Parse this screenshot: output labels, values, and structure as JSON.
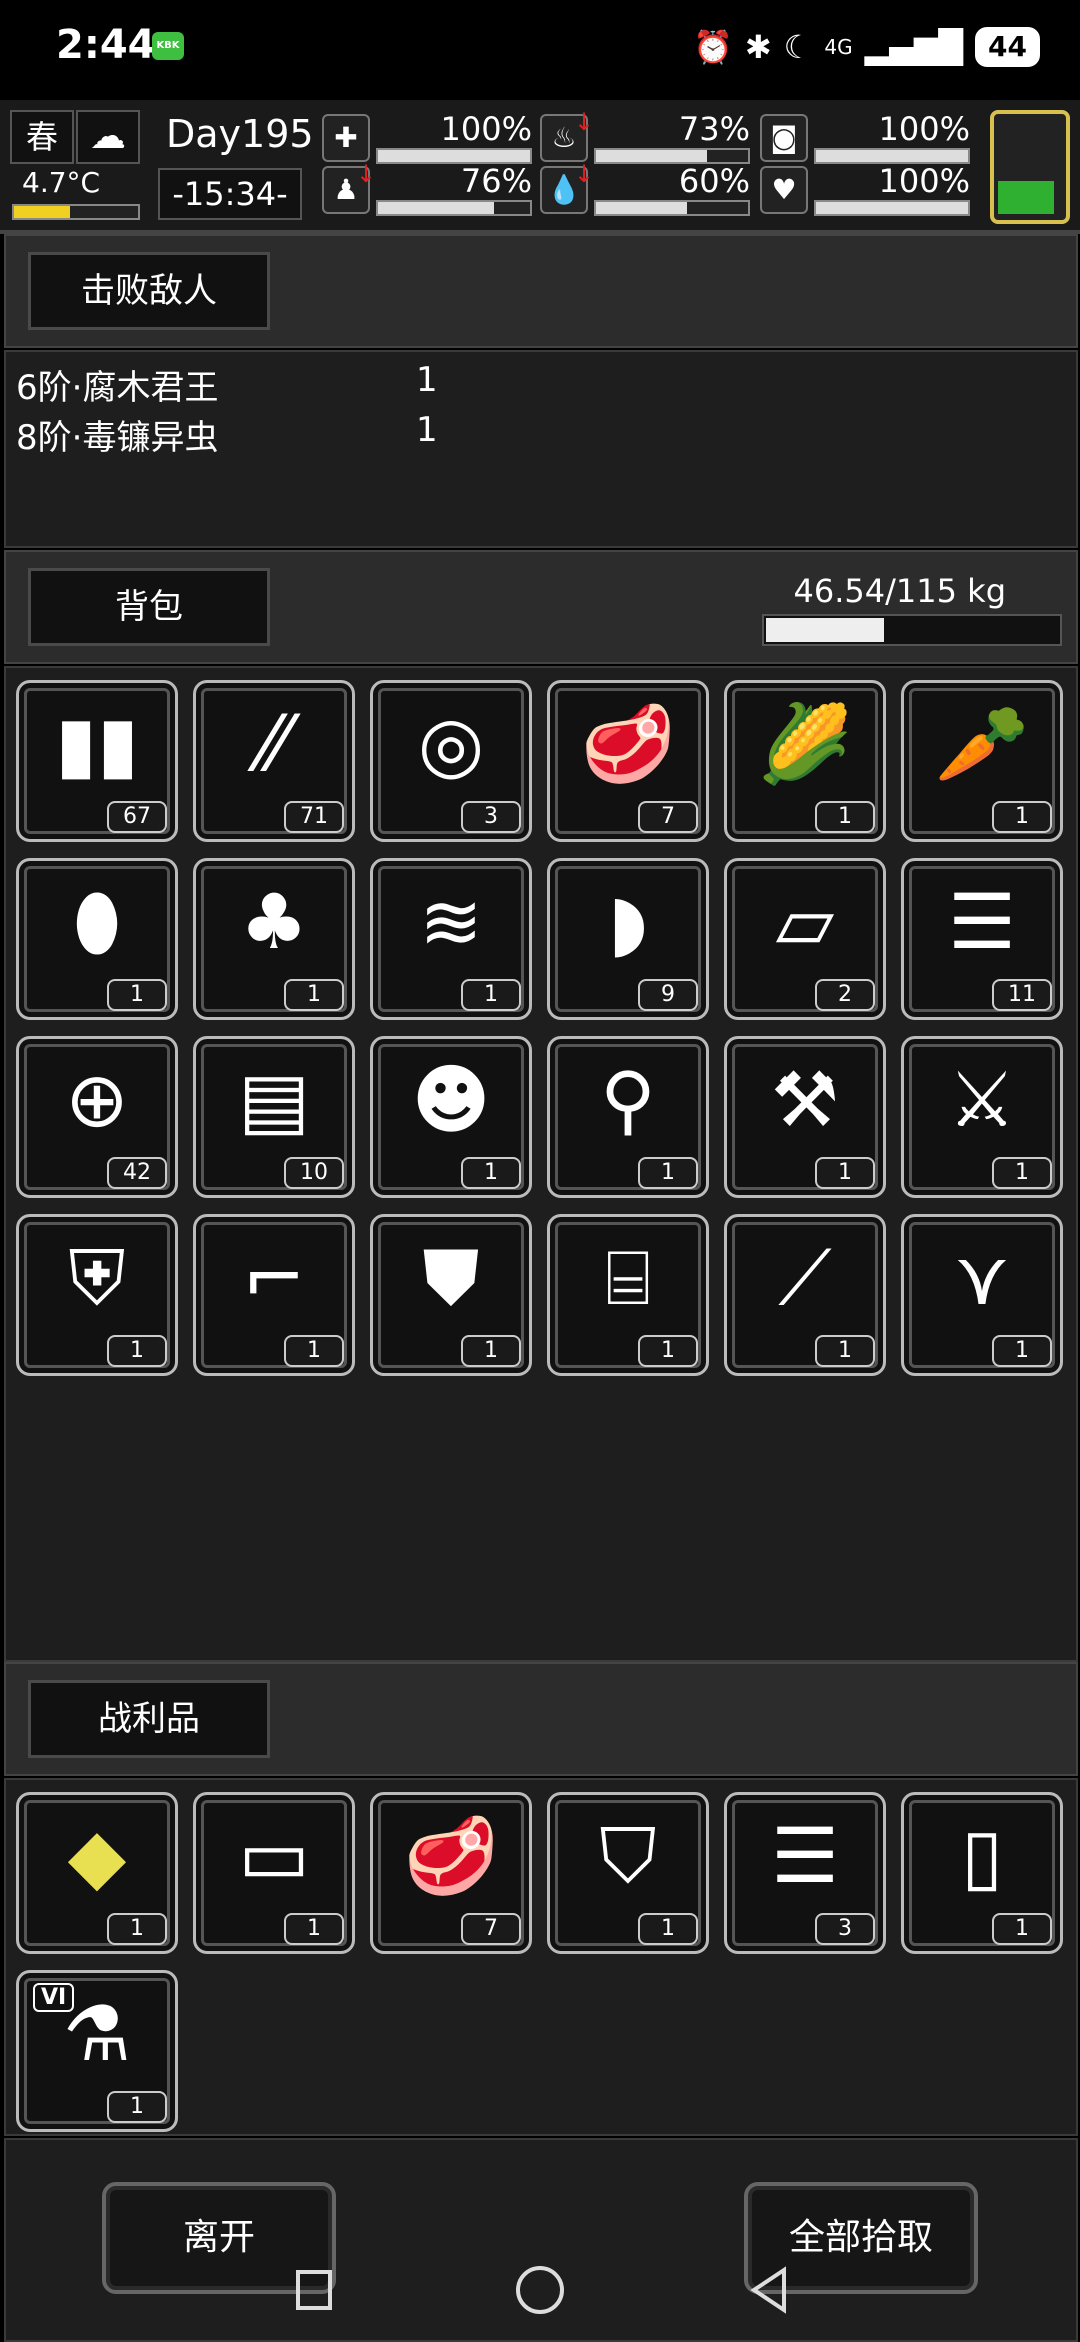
{
  "status_bar": {
    "time": "2:44",
    "notification": "KBK",
    "network": "4G",
    "battery": "44"
  },
  "hud": {
    "season": "春",
    "temperature": "4.7°C",
    "temperature_level": 0.45,
    "day": "Day195",
    "clock": "-15:34-",
    "stats": [
      {
        "icon": "medkit-icon",
        "value": "100%",
        "level": 1.0,
        "decreasing": false
      },
      {
        "icon": "stomach-icon",
        "value": "73%",
        "level": 0.73,
        "decreasing": true
      },
      {
        "icon": "bladder-icon",
        "value": "100%",
        "level": 1.0,
        "decreasing": false
      },
      {
        "icon": "foot-icon",
        "value": "76%",
        "level": 0.76,
        "decreasing": true
      },
      {
        "icon": "water-drop-icon",
        "value": "60%",
        "level": 0.6,
        "decreasing": true
      },
      {
        "icon": "heart-icon",
        "value": "100%",
        "level": 1.0,
        "decreasing": false
      }
    ],
    "energy_level": 0.35
  },
  "defeated": {
    "title": "击败敌人",
    "enemies": [
      {
        "name": "6阶·腐木君王",
        "count": "1"
      },
      {
        "name": "8阶·毒镰异虫",
        "count": "1"
      }
    ]
  },
  "backpack": {
    "title": "背包",
    "weight": "46.54/115 kg",
    "weight_level": 0.4047,
    "items": [
      {
        "icon": "ammo-magazine-icon",
        "count": "67"
      },
      {
        "icon": "rifle-bullets-icon",
        "count": "71"
      },
      {
        "icon": "rope-icon",
        "count": "3"
      },
      {
        "icon": "meat-icon",
        "count": "7"
      },
      {
        "icon": "corn-icon",
        "count": "1"
      },
      {
        "icon": "carrot-icon",
        "count": "1"
      },
      {
        "icon": "potato-icon",
        "count": "1"
      },
      {
        "icon": "fur-pelt-icon",
        "count": "1"
      },
      {
        "icon": "striped-pelt-icon",
        "count": "1"
      },
      {
        "icon": "leather-icon",
        "count": "9"
      },
      {
        "icon": "cloth-icon",
        "count": "2"
      },
      {
        "icon": "folded-cloth-icon",
        "count": "11"
      },
      {
        "icon": "net-icon",
        "count": "42"
      },
      {
        "icon": "grenade-icon",
        "count": "10"
      },
      {
        "icon": "animal-hat-icon",
        "count": "1"
      },
      {
        "icon": "shovel-icon",
        "count": "1"
      },
      {
        "icon": "axe-icon",
        "count": "1"
      },
      {
        "icon": "machete-icon",
        "count": "1"
      },
      {
        "icon": "riot-shield-icon",
        "count": "1"
      },
      {
        "icon": "shotgun-icon",
        "count": "1"
      },
      {
        "icon": "body-armor-icon",
        "count": "1"
      },
      {
        "icon": "backpack-icon",
        "count": "1"
      },
      {
        "icon": "sniper-rifle-icon",
        "count": "1"
      },
      {
        "icon": "knee-pads-icon",
        "count": "1"
      }
    ]
  },
  "loot": {
    "title": "战利品",
    "items": [
      {
        "icon": "gold-crystal-icon",
        "count": "1",
        "color": "#e8e050"
      },
      {
        "icon": "bandage-cloth-icon",
        "count": "1"
      },
      {
        "icon": "meat-icon",
        "count": "7"
      },
      {
        "icon": "ragged-shirt-icon",
        "count": "1"
      },
      {
        "icon": "folded-cloth-icon",
        "count": "3"
      },
      {
        "icon": "paper-sheet-icon",
        "count": "1"
      },
      {
        "icon": "test-tube-icon",
        "count": "1",
        "label": "VI"
      }
    ]
  },
  "actions": {
    "leave": "离开",
    "take_all": "全部拾取"
  }
}
